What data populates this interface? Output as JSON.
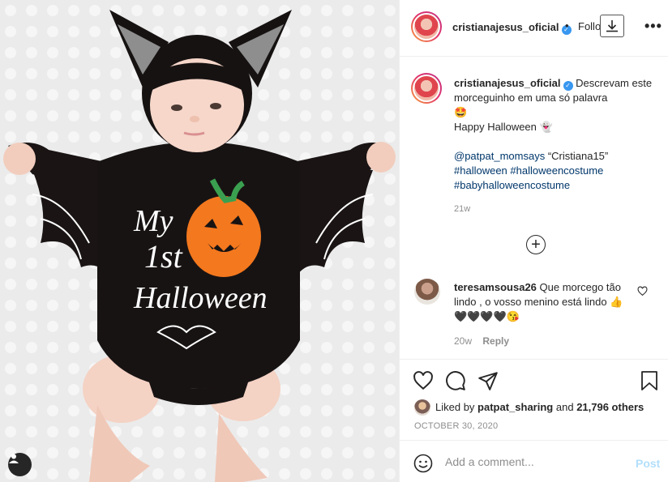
{
  "post": {
    "username": "cristianajesus_oficial",
    "verified_mark": "✓",
    "header_dot": "•",
    "follow_label": "Following",
    "more_label": "•••",
    "caption": {
      "line1": "Descrevam este morceguinho em uma só palavra",
      "emoji1": "🤩",
      "line2": "Happy Halloween",
      "emoji2": "👻",
      "mention": "@patpat_momsays",
      "quote": "“Cristiana15”",
      "hashtags": [
        "#halloween",
        "#halloweencostume",
        "#babyhalloweencostume"
      ]
    },
    "time_ago": "21w",
    "load_more_label": "+",
    "photo": {
      "costume_text": [
        "My",
        "1st",
        "Halloween"
      ]
    }
  },
  "comment": {
    "username": "teresamsousa26",
    "text": "Que morcego tão lindo , o vosso menino está lindo",
    "emojis": "👍🖤🖤🖤🖤😘",
    "time_ago": "20w",
    "reply_label": "Reply"
  },
  "likes": {
    "prefix": "Liked by",
    "user": "patpat_sharing",
    "middle": "and",
    "count": "21,796 others"
  },
  "date": "OCTOBER 30, 2020",
  "add_comment": {
    "placeholder": "Add a comment...",
    "post_label": "Post"
  },
  "colors": {
    "link": "#00376b",
    "verified": "#3897f0",
    "post_button": "#b2dffc",
    "muted": "#8e8e8e"
  },
  "icons": [
    "heart-icon",
    "comment-icon",
    "share-icon",
    "bookmark-icon",
    "emoji-icon",
    "download-icon",
    "user-tag-icon",
    "plus-circle-icon"
  ]
}
